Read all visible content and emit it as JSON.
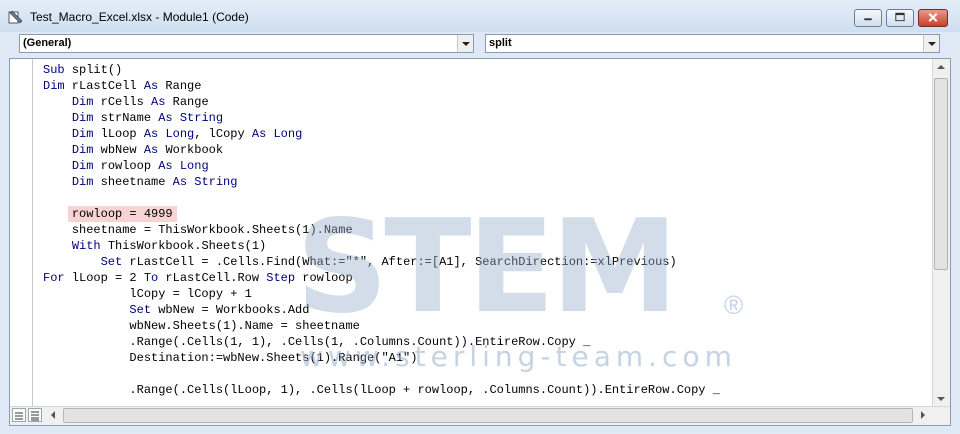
{
  "window": {
    "title": "Test_Macro_Excel.xlsx - Module1 (Code)",
    "icon": "vba-module-icon"
  },
  "controls": {
    "minimize": "minimize-icon",
    "maximize": "maximize-icon",
    "close": "close-icon"
  },
  "object_combo": {
    "value": "(General)"
  },
  "procedure_combo": {
    "value": "split"
  },
  "code": {
    "lines": [
      [
        {
          "t": "Sub",
          "k": 1
        },
        {
          "t": " split()"
        }
      ],
      [
        {
          "t": "Dim",
          "k": 1
        },
        {
          "t": " rLastCell "
        },
        {
          "t": "As",
          "k": 1
        },
        {
          "t": " Range"
        }
      ],
      [
        {
          "t": "    "
        },
        {
          "t": "Dim",
          "k": 1
        },
        {
          "t": " rCells "
        },
        {
          "t": "As",
          "k": 1
        },
        {
          "t": " Range"
        }
      ],
      [
        {
          "t": "    "
        },
        {
          "t": "Dim",
          "k": 1
        },
        {
          "t": " strName "
        },
        {
          "t": "As",
          "k": 1
        },
        {
          "t": " "
        },
        {
          "t": "String",
          "k": 1
        }
      ],
      [
        {
          "t": "    "
        },
        {
          "t": "Dim",
          "k": 1
        },
        {
          "t": " lLoop "
        },
        {
          "t": "As",
          "k": 1
        },
        {
          "t": " "
        },
        {
          "t": "Long",
          "k": 1
        },
        {
          "t": ", lCopy "
        },
        {
          "t": "As",
          "k": 1
        },
        {
          "t": " "
        },
        {
          "t": "Long",
          "k": 1
        }
      ],
      [
        {
          "t": "    "
        },
        {
          "t": "Dim",
          "k": 1
        },
        {
          "t": " wbNew "
        },
        {
          "t": "As",
          "k": 1
        },
        {
          "t": " Workbook"
        }
      ],
      [
        {
          "t": "    "
        },
        {
          "t": "Dim",
          "k": 1
        },
        {
          "t": " rowloop "
        },
        {
          "t": "As",
          "k": 1
        },
        {
          "t": " "
        },
        {
          "t": "Long",
          "k": 1
        }
      ],
      [
        {
          "t": "    "
        },
        {
          "t": "Dim",
          "k": 1
        },
        {
          "t": " sheetname "
        },
        {
          "t": "As",
          "k": 1
        },
        {
          "t": " "
        },
        {
          "t": "String",
          "k": 1
        }
      ],
      [],
      [
        {
          "t": "    "
        },
        {
          "t": "rowloop = 4999",
          "h": 1
        }
      ],
      [
        {
          "t": "    sheetname = ThisWorkbook.Sheets(1).Name"
        }
      ],
      [
        {
          "t": "    "
        },
        {
          "t": "With",
          "k": 1
        },
        {
          "t": " ThisWorkbook.Sheets(1)"
        }
      ],
      [
        {
          "t": "        "
        },
        {
          "t": "Set",
          "k": 1
        },
        {
          "t": " rLastCell = .Cells.Find(What:=\"*\", After:=[A1], SearchDirection:=xlPrevious)"
        }
      ],
      [
        {
          "t": "For",
          "k": 1
        },
        {
          "t": " lLoop = 2 "
        },
        {
          "t": "To",
          "k": 1
        },
        {
          "t": " rLastCell.Row "
        },
        {
          "t": "Step",
          "k": 1
        },
        {
          "t": " rowloop"
        }
      ],
      [
        {
          "t": "            lCopy = lCopy + 1"
        }
      ],
      [
        {
          "t": "            "
        },
        {
          "t": "Set",
          "k": 1
        },
        {
          "t": " wbNew = Workbooks.Add"
        }
      ],
      [
        {
          "t": "            wbNew.Sheets(1).Name = sheetname"
        }
      ],
      [
        {
          "t": "            .Range(.Cells(1, 1), .Cells(1, .Columns.Count)).EntireRow.Copy _"
        }
      ],
      [
        {
          "t": "            Destination:=wbNew.Sheets(1).Range(\"A1\")"
        }
      ],
      [],
      [
        {
          "t": "            .Range(.Cells(lLoop, 1), .Cells(lLoop + rowloop, .Columns.Count)).EntireRow.Copy _"
        }
      ]
    ]
  },
  "watermark": {
    "logo": "STEM",
    "registered": "®",
    "url": "www.sterling-team.com"
  },
  "colors": {
    "keyword": "#00007f",
    "highlight": "#f7d3d3"
  }
}
